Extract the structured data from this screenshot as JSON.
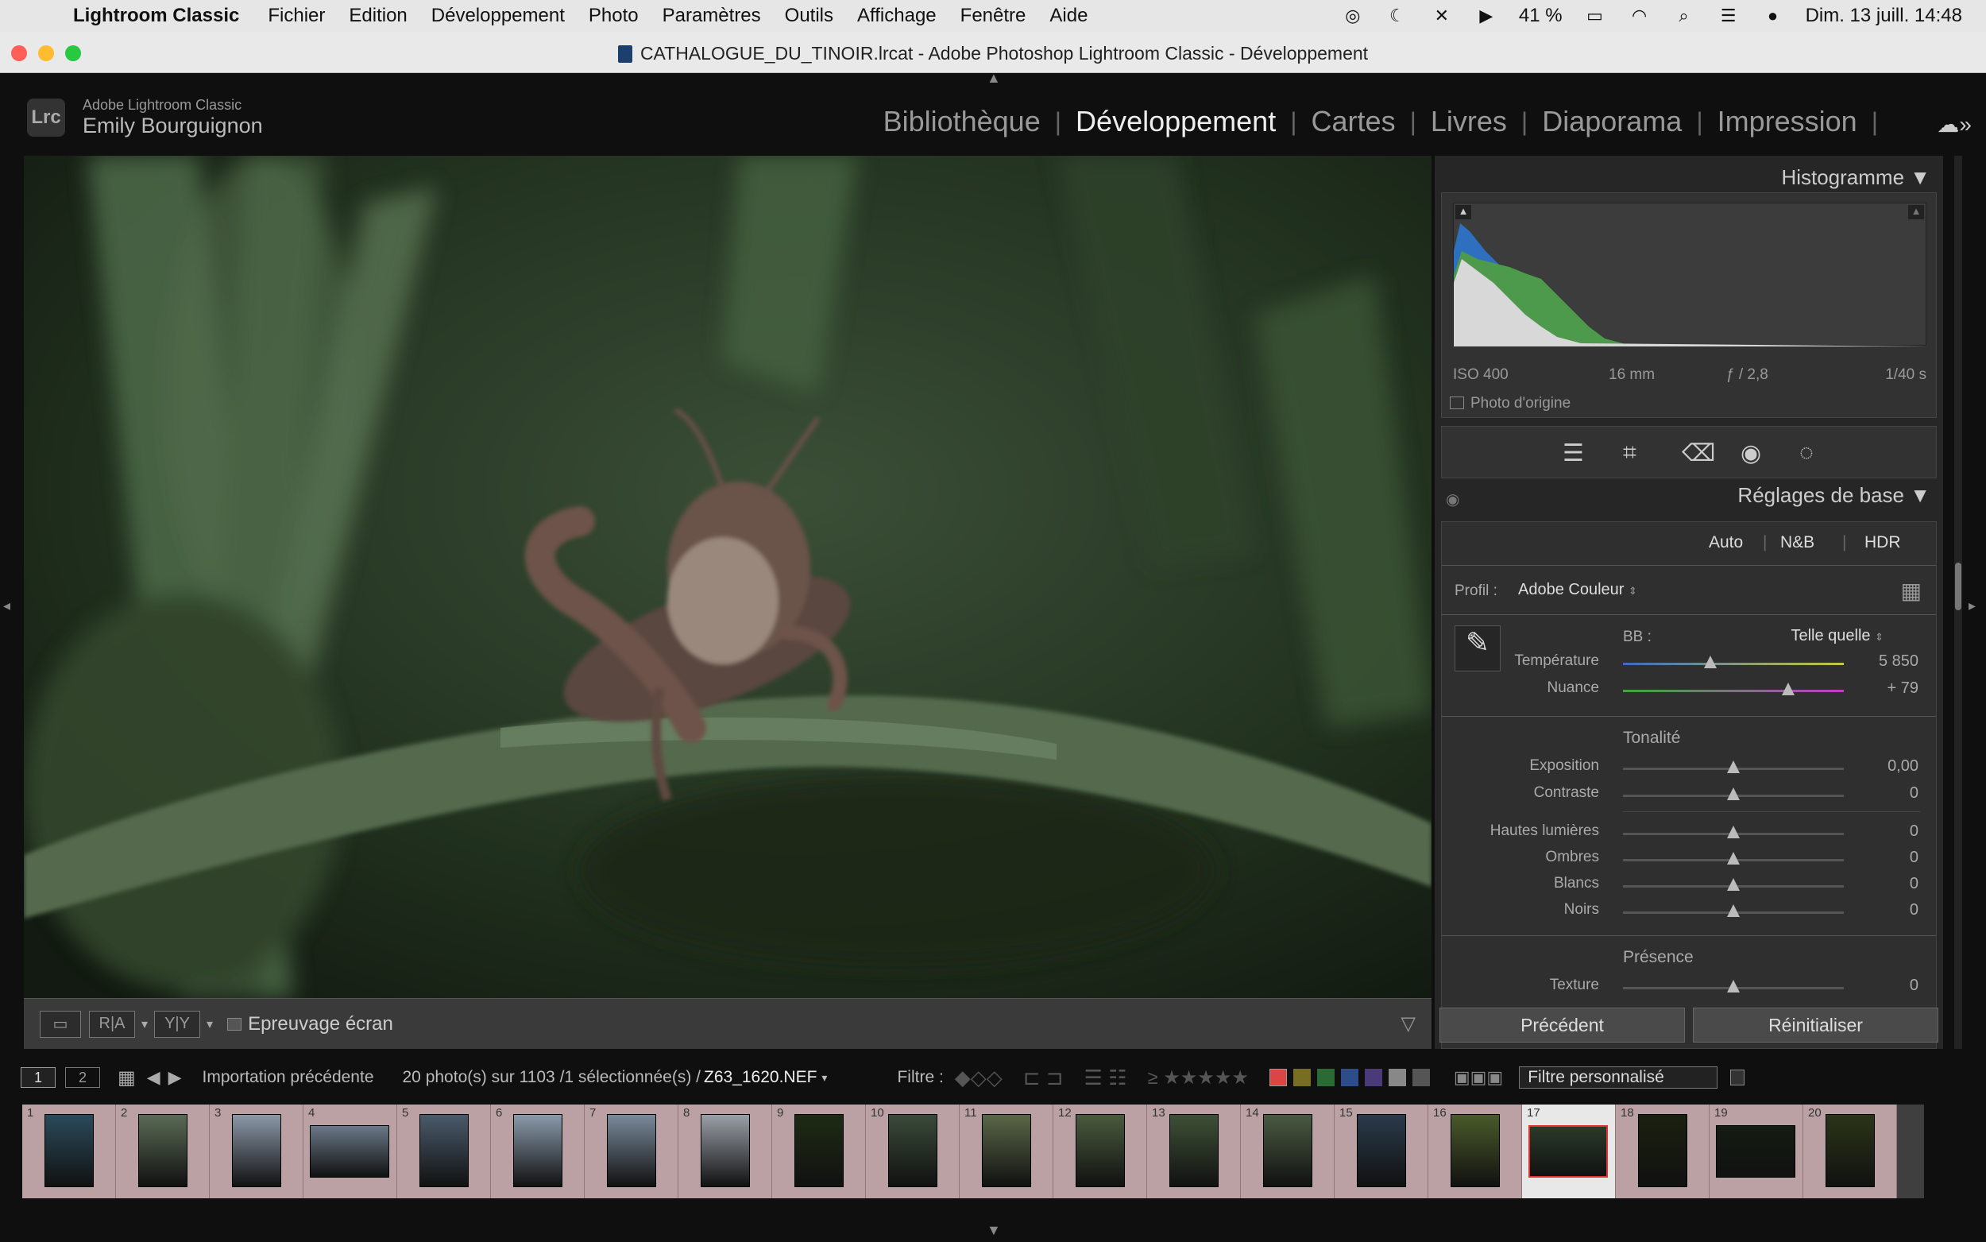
{
  "menubar": {
    "items": [
      "Lightroom Classic",
      "Fichier",
      "Edition",
      "Développement",
      "Photo",
      "Paramètres",
      "Outils",
      "Affichage",
      "Fenêtre",
      "Aide"
    ],
    "battery": "41 %",
    "clock": "Dim. 13 juill. 14:48"
  },
  "window": {
    "title": "CATHALOGUE_DU_TINOIR.lrcat - Adobe Photoshop Lightroom Classic - Développement"
  },
  "identity": {
    "app": "Adobe Lightroom Classic",
    "user": "Emily Bourguignon",
    "logo": "Lrc"
  },
  "modules": [
    "Bibliothèque",
    "Développement",
    "Cartes",
    "Livres",
    "Diaporama",
    "Impression"
  ],
  "histogram": {
    "title": "Histogramme",
    "iso": "ISO 400",
    "focal": "16 mm",
    "aperture": "ƒ / 2,8",
    "shutter": "1/40 s",
    "original": "Photo d'origine"
  },
  "basic": {
    "title": "Réglages de base",
    "auto": "Auto",
    "bw": "N&B",
    "hdr": "HDR",
    "profile_label": "Profil :",
    "profile": "Adobe Couleur",
    "wb_label": "BB :",
    "wb": "Telle quelle",
    "tone": "Tonalité",
    "presence": "Présence",
    "sliders": {
      "temperature": {
        "label": "Température",
        "value": "5 850"
      },
      "tint": {
        "label": "Nuance",
        "value": "+ 79"
      },
      "exposure": {
        "label": "Exposition",
        "value": "0,00"
      },
      "contrast": {
        "label": "Contraste",
        "value": "0"
      },
      "highlights": {
        "label": "Hautes lumières",
        "value": "0"
      },
      "shadows": {
        "label": "Ombres",
        "value": "0"
      },
      "whites": {
        "label": "Blancs",
        "value": "0"
      },
      "blacks": {
        "label": "Noirs",
        "value": "0"
      },
      "texture": {
        "label": "Texture",
        "value": "0"
      }
    }
  },
  "toolbar": {
    "softproof": "Epreuvage écran",
    "before": "Précédent",
    "reset": "Réinitialiser"
  },
  "filmbar": {
    "view1": "1",
    "view2": "2",
    "source": "Importation précédente",
    "count": "20 photo(s) sur 1103 /1 sélectionnée(s) /",
    "filename": "Z63_1620.NEF",
    "filter_label": "Filtre :",
    "filter_value": "Filtre personnalisé"
  },
  "filmstrip": {
    "numbers": [
      "1",
      "2",
      "3",
      "4",
      "5",
      "6",
      "7",
      "8",
      "9",
      "10",
      "11",
      "12",
      "13",
      "14",
      "15",
      "16",
      "17",
      "18",
      "19",
      "20"
    ],
    "selected": 17
  }
}
